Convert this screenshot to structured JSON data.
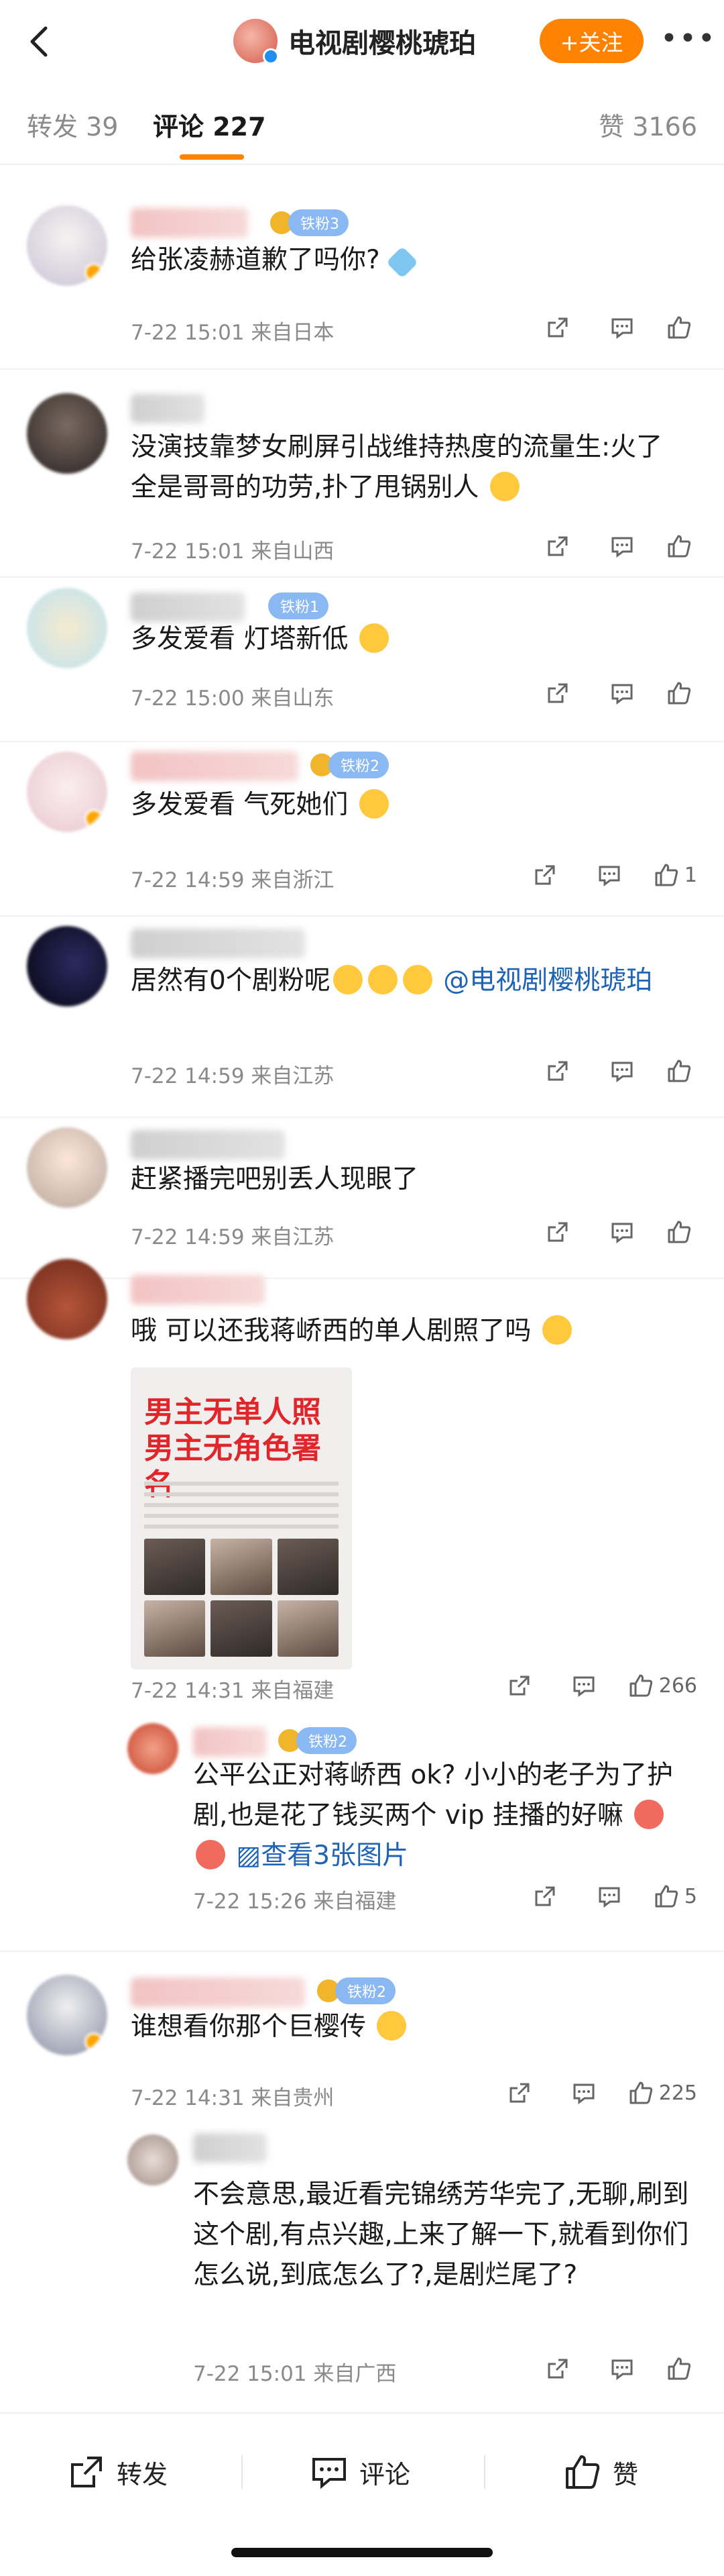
{
  "header": {
    "title": "电视剧樱桃琥珀",
    "follow_label": "+关注",
    "more_label": "•••"
  },
  "tabs": {
    "repost": "转发 39",
    "comment": "评论 227",
    "like": "赞 3166"
  },
  "comments": [
    {
      "text": "给张凌赫道歉了吗你?",
      "fan_badge": "铁粉3",
      "time": "7-22 15:01",
      "source": "来自日本",
      "likes": ""
    },
    {
      "text": "没演技靠梦女刷屏引战维持热度的流量生:火了全是哥哥的功劳,扑了甩锅别人",
      "time": "7-22 15:01",
      "source": "来自山西",
      "likes": ""
    },
    {
      "text": "多发爱看 灯塔新低",
      "fan_badge": "铁粉1",
      "time": "7-22 15:00",
      "source": "来自山东",
      "likes": ""
    },
    {
      "text": "多发爱看 气死她们",
      "fan_badge": "铁粉2",
      "time": "7-22 14:59",
      "source": "来自浙江",
      "likes": "1"
    },
    {
      "text": "居然有0个剧粉呢",
      "mention": "@电视剧樱桃琥珀",
      "time": "7-22 14:59",
      "source": "来自江苏",
      "likes": ""
    },
    {
      "text": "赶紧播完吧别丢人现眼了",
      "time": "7-22 14:59",
      "source": "来自江苏",
      "likes": ""
    },
    {
      "text": "哦 可以还我蒋峤西的单人剧照了吗",
      "thumb_title": "男主无单人照 男主无角色署名",
      "time": "7-22 14:31",
      "source": "来自福建",
      "likes": "266"
    },
    {
      "text": "公平公正对蒋峤西 ok? 小小的老子为了护剧,也是花了钱买两个 vip 挂播的好嘛",
      "fan_badge": "铁粉2",
      "image_link": "查看3张图片",
      "time": "7-22 15:26",
      "source": "来自福建",
      "likes": "5"
    },
    {
      "text": "谁想看你那个巨樱传",
      "fan_badge": "铁粉2",
      "time": "7-22 14:31",
      "source": "来自贵州",
      "likes": "225"
    },
    {
      "text": "不会意思,最近看完锦绣芳华完了,无聊,刷到这个剧,有点兴趣,上来了解一下,就看到你们怎么说,到底怎么了?,是剧烂尾了?",
      "time": "7-22 15:01",
      "source": "来自广西",
      "likes": ""
    }
  ],
  "bottom_bar": {
    "repost": "转发",
    "comment": "评论",
    "like": "赞"
  },
  "colors": {
    "accent": "#ff8200",
    "link": "#1f63b5",
    "muted": "#8a8a8a"
  }
}
